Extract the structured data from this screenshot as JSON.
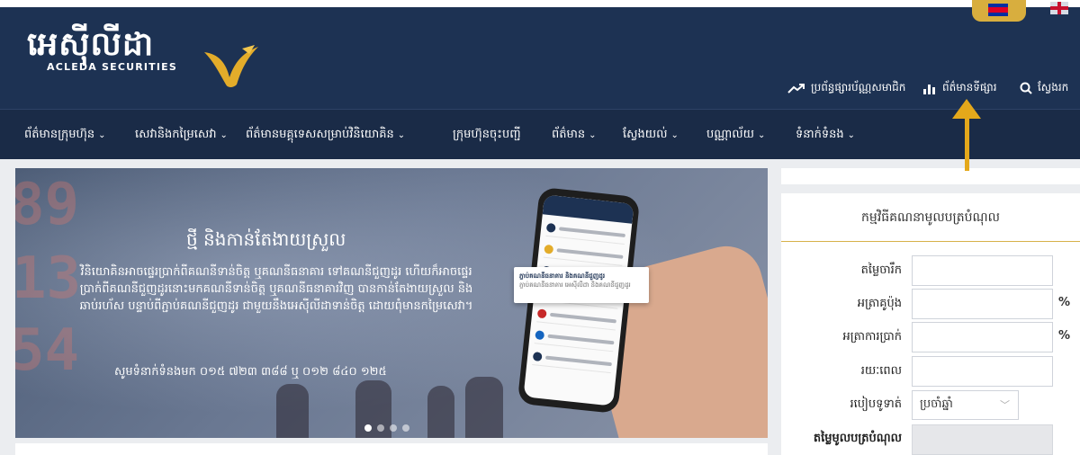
{
  "logo": {
    "khmer": "អេស៊ីលីដា",
    "english": "ACLEDA SECURITIES"
  },
  "utility": {
    "market_label": "ប្រព័ន្ធផ្សារប័ណ្ណសមាជិក",
    "info_label": "ព័ត៌មានទីផ្សារ",
    "search_label": "ស្វែងរក"
  },
  "nav": {
    "items": [
      {
        "label": "ព័ត៌មានក្រុមហ៊ុន",
        "chevron": "⌄"
      },
      {
        "label": "សេវានិងកម្រៃសេវា",
        "chevron": "⌄"
      },
      {
        "label": "ព័ត៌មានមគ្គុទេសសម្រាប់វិនិយោគិន",
        "chevron": "⌄"
      },
      {
        "label": "ក្រុមហ៊ុនចុះបញ្ជី",
        "chevron": ""
      },
      {
        "label": "ព័ត៌មាន",
        "chevron": "⌄"
      },
      {
        "label": "ស្វែងយល់",
        "chevron": "⌄"
      },
      {
        "label": "បណ្ណាល័យ",
        "chevron": "⌄"
      },
      {
        "label": "ទំនាក់ទំនង",
        "chevron": "⌄"
      }
    ]
  },
  "banner": {
    "title": "ថ្មី និងកាន់តែងាយស្រួល",
    "body": "វិនិយោគិនអាចផ្ទេរប្រាក់ពីគណនីទាន់ចិត្ត ឬគណនីធនាគារ ទៅគណនីជួញដូរ ហើយក៏អាចផ្ទេរប្រាក់ពីគណនីជួញដូរនោះមកគណនីទាន់ចិត្ត ឬគណនីធនាគារវិញ បានកាន់តែងាយស្រួល និងឆាប់រហ័ស បន្ទាប់ពីភ្ជាប់គណនីជួញដូរ ជាមួយនឹងអេស៊ីលីដាទាន់ចិត្ត ដោយពុំមានកម្រៃសេវា។",
    "contact": "សូមទំនាក់ទំនងមក ០១៥ ៧២៣ ៣៨៨ ឬ ០១២ ៨៤០ ១២៥",
    "card_title": "ភ្ជាប់គណនីធនាគារ និងគណនីជួញដូរ",
    "card_sub": "ភ្ជាប់គណនីធនាគារ អេស៊ីលីដា និងគណនីជួញដូរ",
    "slides": 4,
    "active_slide": 1
  },
  "calculator": {
    "title": "កម្មវិធីគណនាមូលបត្របំណុល",
    "fields": {
      "face_value": {
        "label": "តម្លៃចារឹក",
        "value": ""
      },
      "coupon": {
        "label": "អត្រាគូប៉ុង",
        "value": "",
        "unit": "%"
      },
      "interest": {
        "label": "អត្រាការប្រាក់",
        "value": "",
        "unit": "%"
      },
      "period": {
        "label": "រយៈពេល",
        "value": ""
      },
      "payment": {
        "label": "របៀបទូទាត់",
        "value": "ប្រចាំឆ្នាំ"
      },
      "result": {
        "label": "តម្លៃមូលបត្របំណុល",
        "value": ""
      }
    }
  },
  "colors": {
    "header_bg": "#1d3253",
    "nav_bg": "#1a2b47",
    "accent_gold": "#d7b24a",
    "arrow": "#e4a81b"
  }
}
